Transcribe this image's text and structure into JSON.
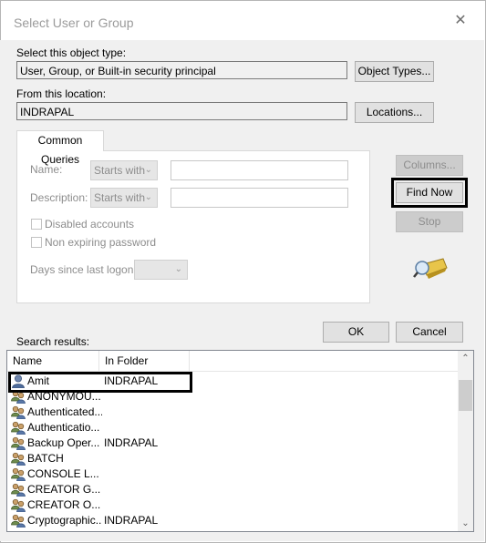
{
  "window": {
    "title": "Select User or Group",
    "close_glyph": "✕"
  },
  "object_type": {
    "label": "Select this object type:",
    "value": "User, Group, or Built-in security principal",
    "button": "Object Types..."
  },
  "location": {
    "label": "From this location:",
    "value": "INDRAPAL",
    "button": "Locations..."
  },
  "tab": {
    "label": "Common Queries"
  },
  "query": {
    "name_label": "Name:",
    "name_mode": "Starts with",
    "description_label": "Description:",
    "description_mode": "Starts with",
    "disabled_accounts": "Disabled accounts",
    "non_expiring_password": "Non expiring password",
    "days_label": "Days since last logon:"
  },
  "buttons": {
    "columns": "Columns...",
    "find_now": "Find Now",
    "stop": "Stop",
    "ok": "OK",
    "cancel": "Cancel"
  },
  "search_results": {
    "label": "Search results:",
    "columns": [
      "Name",
      "In Folder"
    ],
    "rows": [
      {
        "name": "Amit",
        "folder": "INDRAPAL",
        "icon": "user-icon"
      },
      {
        "name": "ANONYMOU...",
        "folder": "",
        "icon": "group-icon"
      },
      {
        "name": "Authenticated...",
        "folder": "",
        "icon": "group-icon"
      },
      {
        "name": "Authenticatio...",
        "folder": "",
        "icon": "group-icon"
      },
      {
        "name": "Backup Oper...",
        "folder": "INDRAPAL",
        "icon": "group-icon"
      },
      {
        "name": "BATCH",
        "folder": "",
        "icon": "group-icon"
      },
      {
        "name": "CONSOLE L...",
        "folder": "",
        "icon": "group-icon"
      },
      {
        "name": "CREATOR G...",
        "folder": "",
        "icon": "group-icon"
      },
      {
        "name": "CREATOR O...",
        "folder": "",
        "icon": "group-icon"
      },
      {
        "name": "Cryptographic...",
        "folder": "INDRAPAL",
        "icon": "group-icon"
      }
    ]
  },
  "colors": {
    "highlight_border": "#000000",
    "disabled_text": "#8d8d8d"
  }
}
